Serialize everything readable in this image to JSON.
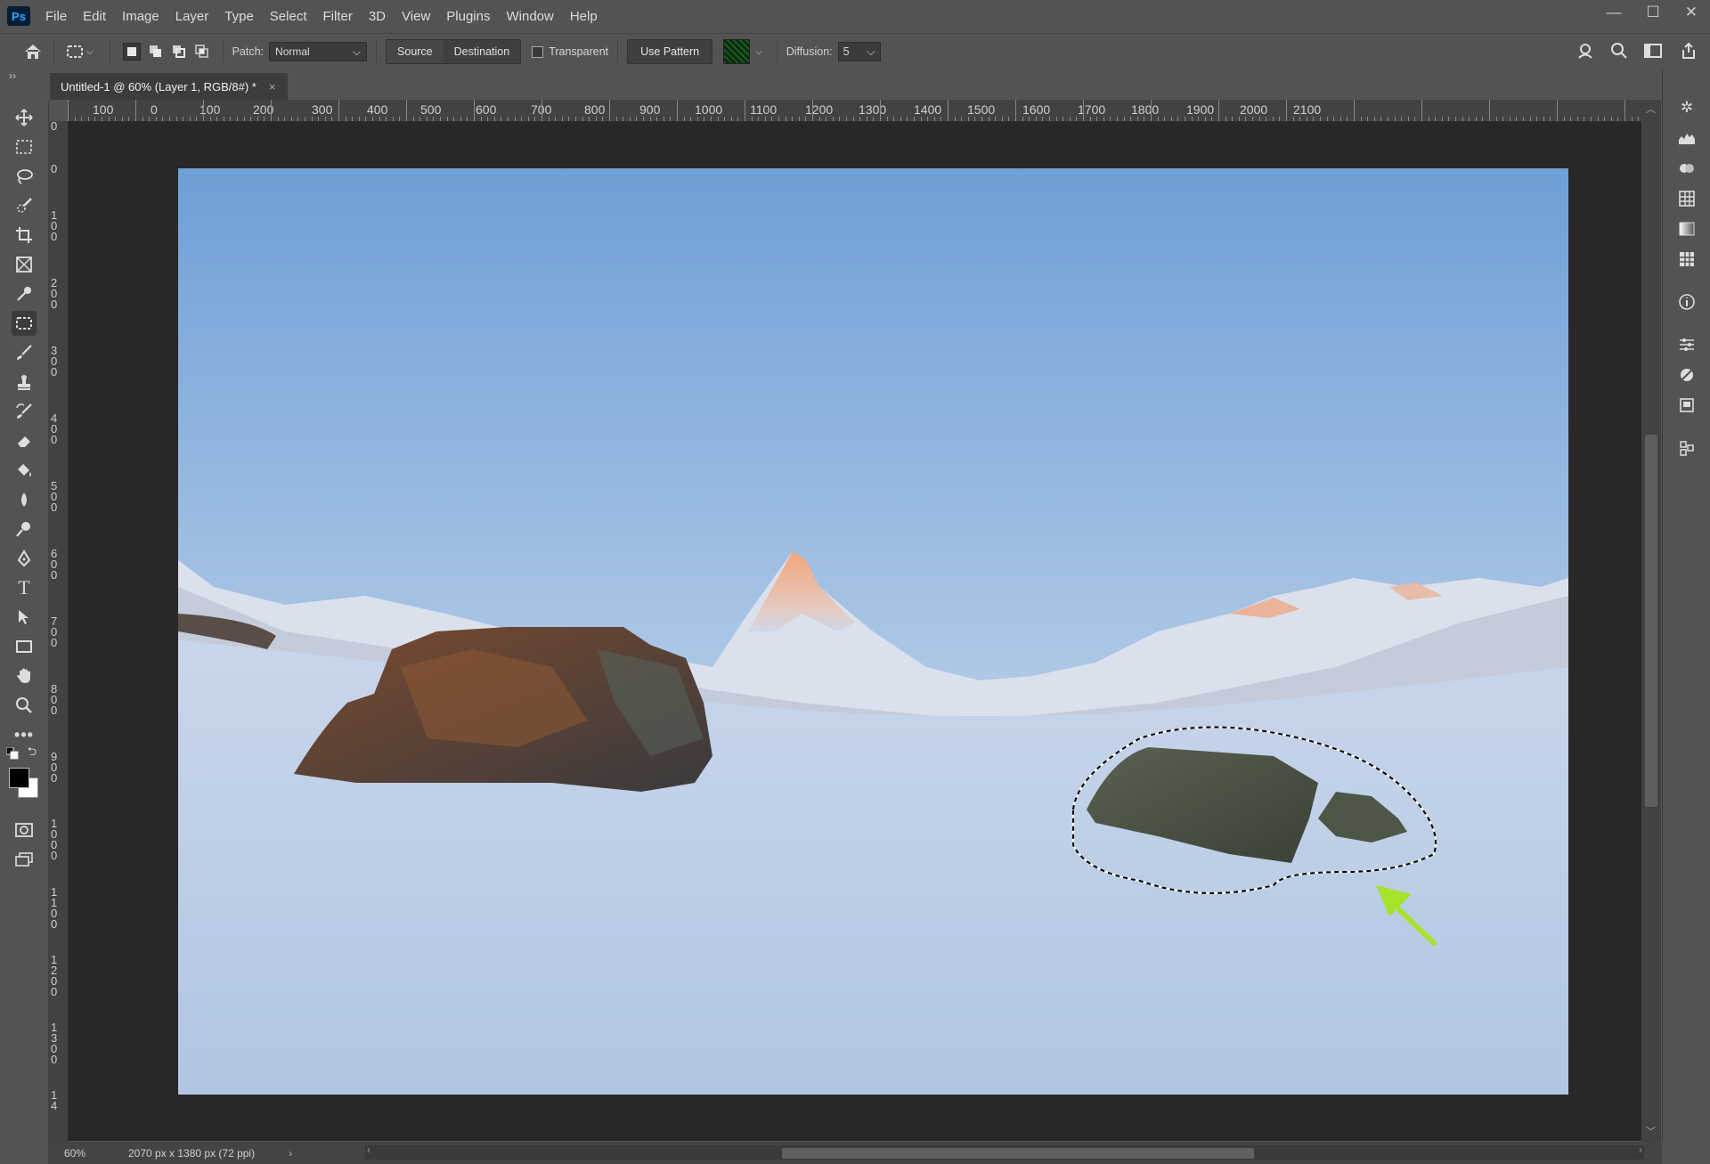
{
  "app": {
    "logo": "Ps"
  },
  "menu": [
    "File",
    "Edit",
    "Image",
    "Layer",
    "Type",
    "Select",
    "Filter",
    "3D",
    "View",
    "Plugins",
    "Window",
    "Help"
  ],
  "window_controls": {
    "minimize": "—",
    "maximize": "☐",
    "close": "✕"
  },
  "options_bar": {
    "patch_label": "Patch:",
    "patch_mode": "Normal",
    "source_label": "Source",
    "destination_label": "Destination",
    "transparent_label": "Transparent",
    "use_pattern_label": "Use Pattern",
    "diffusion_label": "Diffusion:",
    "diffusion_value": "5"
  },
  "document_tab": {
    "title": "Untitled-1 @ 60% (Layer 1, RGB/8#) *",
    "close": "×"
  },
  "ruler_top": [
    "100",
    "0",
    "100",
    "200",
    "300",
    "400",
    "500",
    "600",
    "700",
    "800",
    "900",
    "1000",
    "1100",
    "1200",
    "1300",
    "1400",
    "1500",
    "1600",
    "1700",
    "1800",
    "1900",
    "2000",
    "2100"
  ],
  "ruler_left": [
    "0",
    "0",
    "1\n0\n0",
    "2\n0\n0",
    "3\n0\n0",
    "4\n0\n0",
    "5\n0\n0",
    "6\n0\n0",
    "7\n0\n0",
    "8\n0\n0",
    "9\n0\n0",
    "1\n0\n0\n0",
    "1\n1\n0\n0",
    "1\n2\n0\n0",
    "1\n3\n0\n0",
    "1\n4"
  ],
  "status": {
    "zoom": "60%",
    "doc_info": "2070 px x 1380 px (72 ppi)"
  },
  "colors": {
    "foreground": "#000000",
    "background": "#ffffff",
    "annotation_arrow": "#a6e22e",
    "ui_bg": "#535353",
    "canvas_bg": "#282828"
  }
}
